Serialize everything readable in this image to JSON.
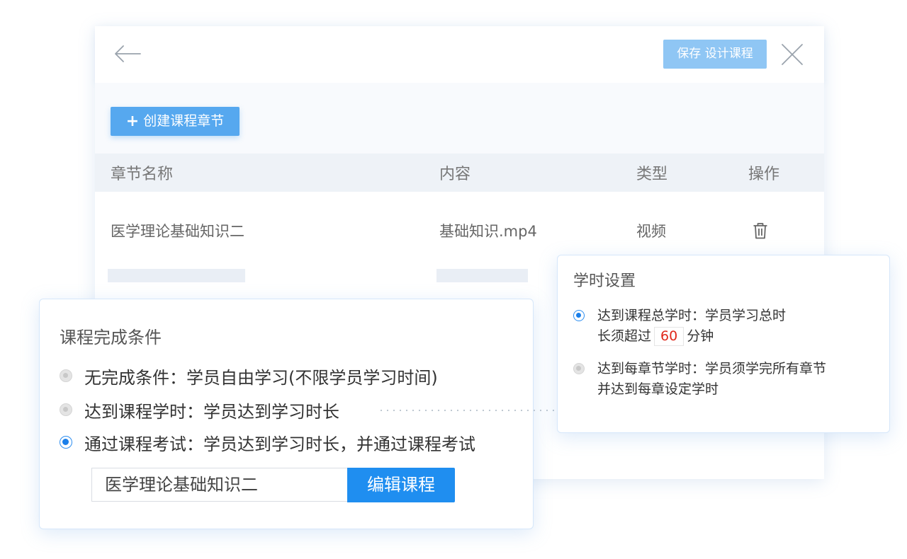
{
  "header": {
    "save_label": "保存 设计课程"
  },
  "toolbar": {
    "create_plus": "+",
    "create_label": "创建课程章节"
  },
  "table": {
    "columns": [
      "章节名称",
      "内容",
      "类型",
      "操作"
    ],
    "rows": [
      {
        "name": "医学理论基础知识二",
        "content": "基础知识.mp4",
        "type": "视频"
      }
    ]
  },
  "completion": {
    "title": "课程完成条件",
    "options": [
      {
        "label": "无完成条件：学员自由学习(不限学员学习时间)",
        "selected": false
      },
      {
        "label": "达到课程学时：学员达到学习时长",
        "selected": false
      },
      {
        "label": "通过课程考试：学员达到学习时长，并通过课程考试",
        "selected": true
      }
    ],
    "course_value": "医学理论基础知识二",
    "edit_label": "编辑课程"
  },
  "study_hours": {
    "title": "学时设置",
    "option1": {
      "line1": "达到课程总学时：学员学习总时",
      "line2_prefix": "长须超过",
      "minutes": "60",
      "line2_suffix": "分钟",
      "selected": true
    },
    "option2": {
      "line1": "达到每章节学时：学员须学完所有章节",
      "line2": "并达到每章设定学时",
      "selected": false
    }
  },
  "colors": {
    "primary": "#1f8ef0",
    "save_button": "#8fc6f4",
    "create_button": "#56a8ef",
    "minutes_text": "#e0281b"
  },
  "icons": [
    "back-arrow-icon",
    "close-icon",
    "plus-icon",
    "trash-icon"
  ]
}
